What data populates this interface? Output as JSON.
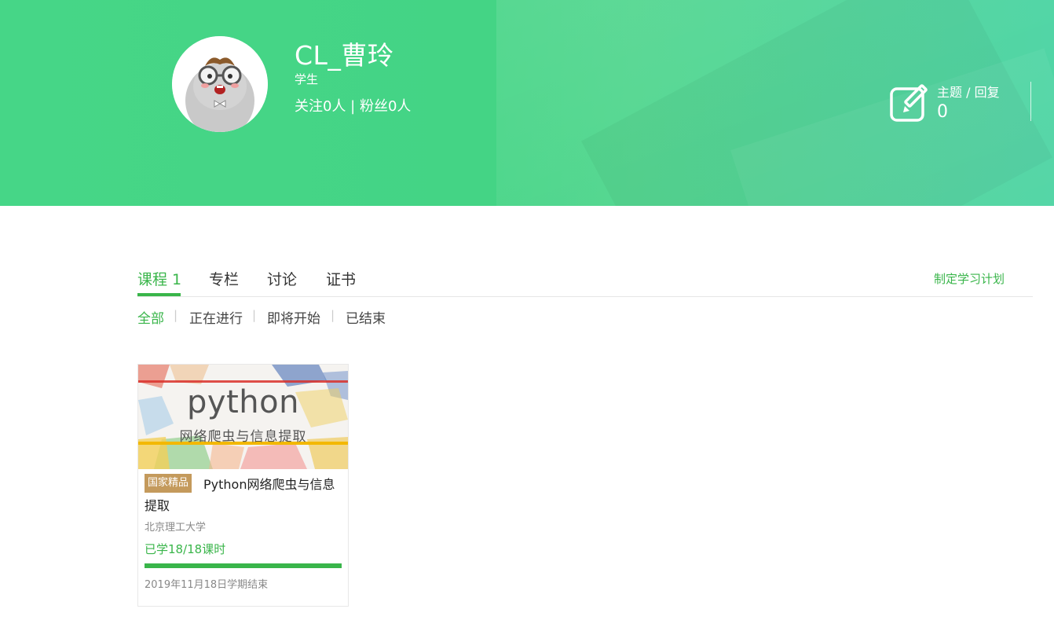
{
  "profile": {
    "name": "CL_曹玲",
    "role": "学生",
    "follow_text": "关注0人 | 粉丝0人"
  },
  "stats": {
    "topic_label": "主题 / 回复",
    "topic_value": "0",
    "icon": "edit-icon"
  },
  "tabs": [
    {
      "label": "课程 1",
      "active": true
    },
    {
      "label": "专栏",
      "active": false
    },
    {
      "label": "讨论",
      "active": false
    },
    {
      "label": "证书",
      "active": false
    }
  ],
  "plan_link": "制定学习计划",
  "filters": [
    {
      "label": "全部",
      "active": true
    },
    {
      "label": "正在进行",
      "active": false
    },
    {
      "label": "即将开始",
      "active": false
    },
    {
      "label": "已结束",
      "active": false
    }
  ],
  "filter_separator": "|",
  "course": {
    "cover_title": "python",
    "cover_subtitle": "网络爬虫与信息提取",
    "badge": "国家精品",
    "title_line1": "Python网络爬虫与信息",
    "title_line2": "提取",
    "school": "北京理工大学",
    "progress_text": "已学18/18课时",
    "progress_fraction": 1.0,
    "end_text": "2019年11月18日学期结束"
  },
  "colors": {
    "accent": "#39b54a",
    "banner": "#46d687",
    "badge": "#c49a5c"
  }
}
